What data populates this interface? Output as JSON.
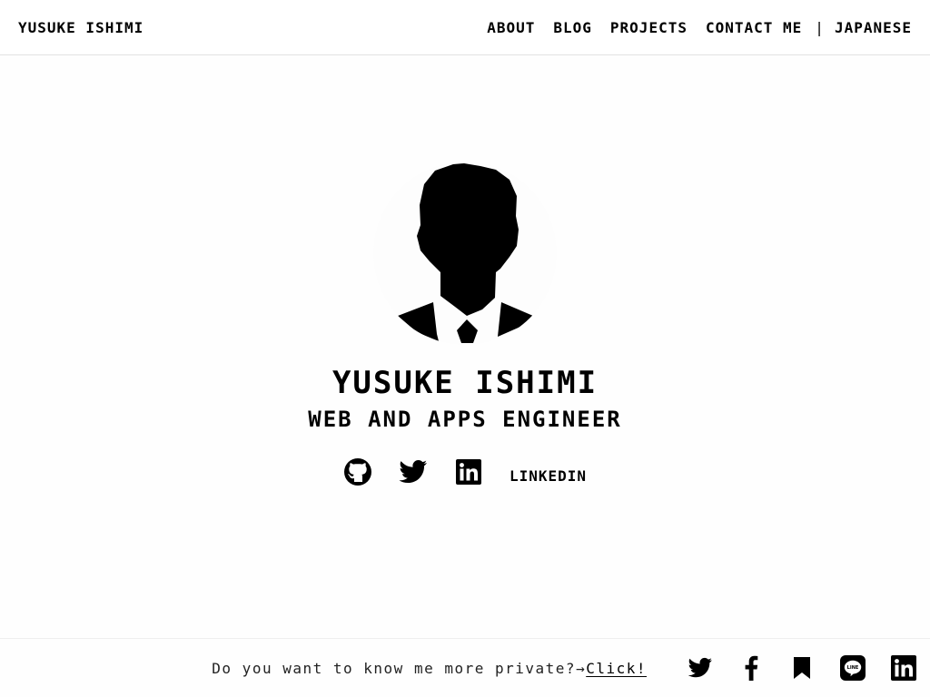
{
  "header": {
    "brand": "YUSUKE ISHIMI",
    "nav": {
      "about": "ABOUT",
      "blog": "BLOG",
      "projects": "PROJECTS",
      "contact": "CONTACT ME",
      "separator": "|",
      "language": "JAPANESE"
    }
  },
  "profile": {
    "avatar_icon": "person-silhouette-icon",
    "name": "YUSUKE ISHIMI",
    "role": "WEB AND APPS ENGINEER",
    "social": {
      "icons": [
        "github-icon",
        "twitter-icon",
        "linkedin-icon"
      ],
      "label": "LINKEDIN"
    }
  },
  "footer": {
    "question": "Do you want to know me more private?→",
    "click": "Click!",
    "icons": [
      "twitter-icon",
      "facebook-icon",
      "bookmark-icon",
      "line-icon",
      "linkedin-icon"
    ]
  },
  "colors": {
    "text": "#000000",
    "background": "#ffffff",
    "border": "#e2e2e2"
  }
}
